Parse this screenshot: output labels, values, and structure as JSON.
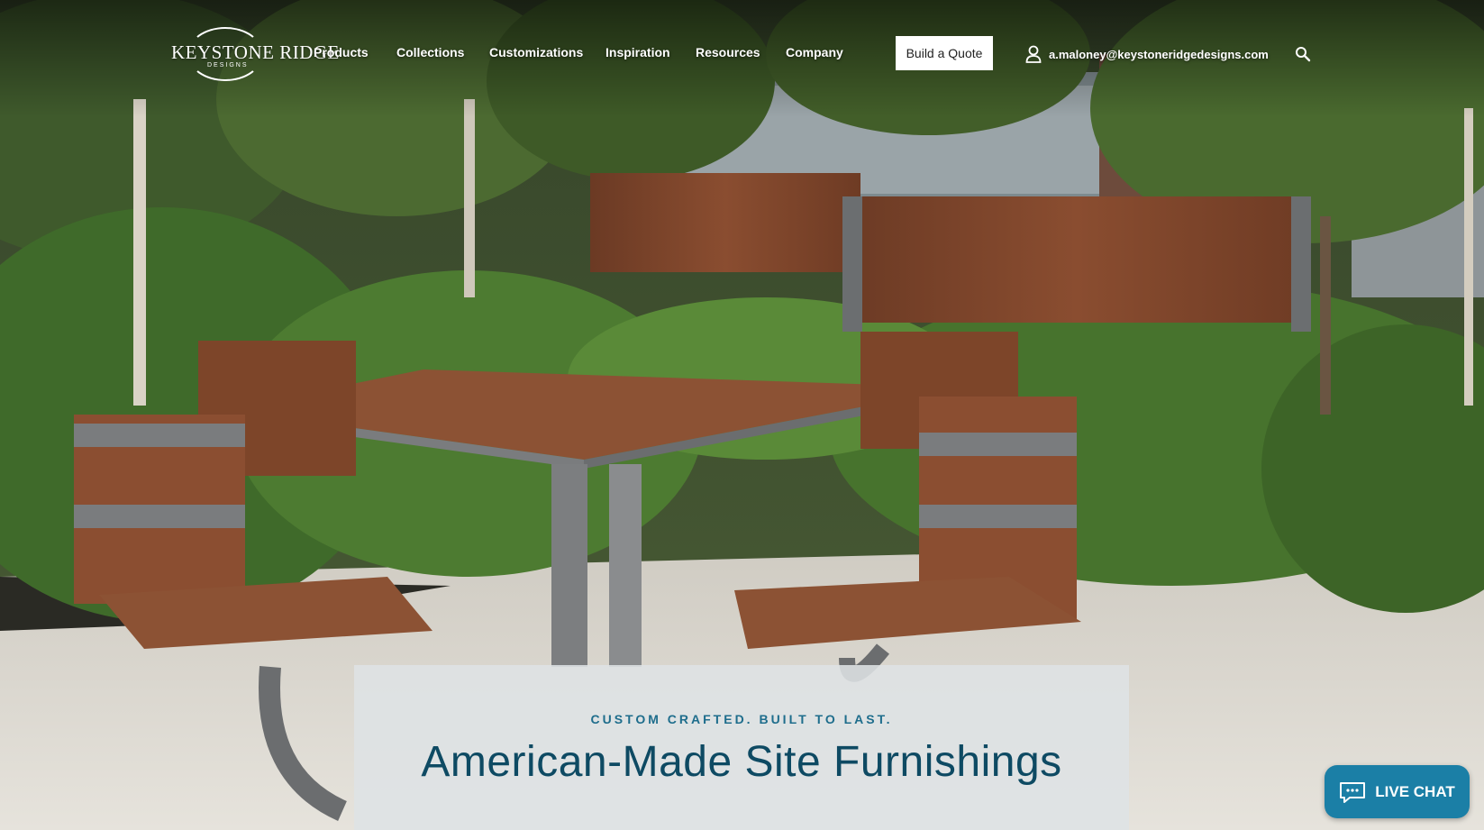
{
  "brand": {
    "logo_text": "KEYSTONE RIDGE",
    "logo_subtext": "DESIGNS"
  },
  "nav": {
    "items": [
      "Products",
      "Collections",
      "Customizations",
      "Inspiration",
      "Resources",
      "Company"
    ],
    "cta_label": "Build a Quote",
    "user_email": "a.maloney@keystoneridgedesigns.com",
    "user_icon": "user-icon",
    "search_icon": "search-icon"
  },
  "hero": {
    "eyebrow": "CUSTOM CRAFTED. BUILT TO LAST.",
    "headline": "American-Made Site Furnishings"
  },
  "chat": {
    "label": "LIVE CHAT",
    "icon": "chat-bubble-icon"
  },
  "colors": {
    "accent": "#1b7fa6",
    "headline": "#0e4a63",
    "eyebrow": "#1e6d8c"
  }
}
